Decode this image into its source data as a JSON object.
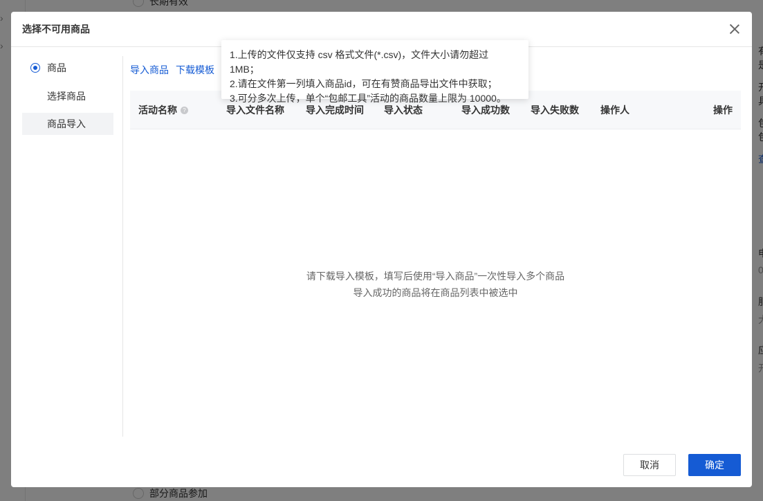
{
  "background": {
    "radio_top_label": "长期有效",
    "radio_bottom_label": "部分商品参加",
    "right_column_chars": [
      "有",
      "是",
      "开",
      "具",
      "包",
      "包",
      "查",
      "申",
      "0",
      "服",
      "大",
      "应",
      "开"
    ]
  },
  "dialog": {
    "title": "选择不可用商品",
    "nav": {
      "group_label": "商品",
      "items": [
        {
          "label": "选择商品",
          "active": false
        },
        {
          "label": "商品导入",
          "active": true
        }
      ]
    },
    "actions": {
      "import_label": "导入商品",
      "download_label": "下载模板"
    },
    "table": {
      "columns": [
        "活动名称",
        "导入文件名称",
        "导入完成时间",
        "导入状态",
        "导入成功数",
        "导入失败数",
        "操作人",
        "操作"
      ]
    },
    "empty": {
      "line1": "请下载导入模板，填写后使用“导入商品”一次性导入多个商品",
      "line2": "导入成功的商品将在商品列表中被选中"
    },
    "tooltip": {
      "line1": "1.上传的文件仅支持 csv 格式文件(*.csv)，文件大小请勿超过 1MB；",
      "line2": "2.请在文件第一列填入商品id，可在有赞商品导出文件中获取；",
      "line3": "3.可分多次上传，单个“包邮工具”活动的商品数量上限为 10000。"
    },
    "footer": {
      "cancel_label": "取消",
      "ok_label": "确定"
    }
  },
  "colors": {
    "primary": "#155bd4",
    "overlay": "rgba(0,0,0,0.5)"
  }
}
